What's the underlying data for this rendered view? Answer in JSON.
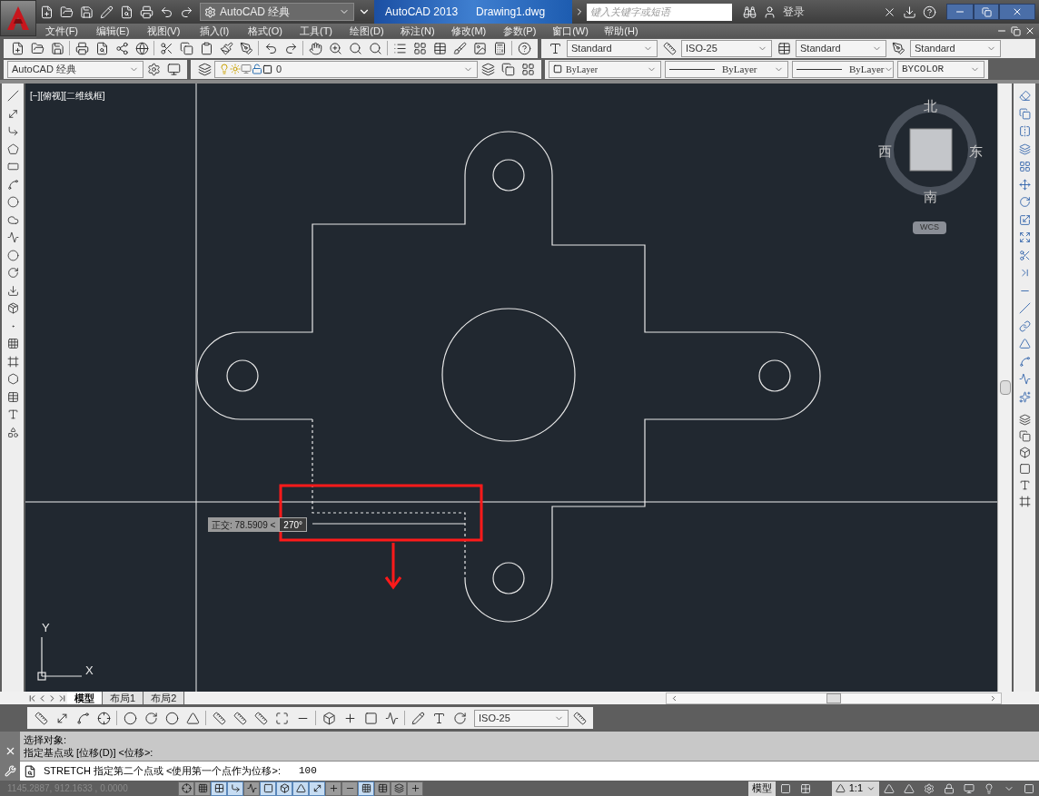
{
  "title_bar": {
    "workspace": "AutoCAD 经典",
    "app_name": "AutoCAD 2013",
    "document": "Drawing1.dwg",
    "search": {
      "placeholder": "键入关键字或短语"
    },
    "login": "登录"
  },
  "menu": [
    "文件(F)",
    "编辑(E)",
    "视图(V)",
    "插入(I)",
    "格式(O)",
    "工具(T)",
    "绘图(D)",
    "标注(N)",
    "修改(M)",
    "参数(P)",
    "窗口(W)",
    "帮助(H)"
  ],
  "styles_toolbar": {
    "text_style": "Standard",
    "dim_style": "ISO-25",
    "table_style": "Standard",
    "multileader_style": "Standard"
  },
  "layers_toolbar": {
    "workspace": "AutoCAD 经典",
    "layer": "0",
    "color_control": "ByLayer",
    "linetype": "ByLayer",
    "lineweight": "ByLayer",
    "plot_style": "BYCOLOR"
  },
  "viewport": {
    "label": "[−][俯视][二维线框]",
    "viewcube": {
      "north": "北",
      "south": "南",
      "east": "东",
      "west": "西",
      "ucs": "WCS"
    },
    "tooltip": {
      "label": "正交: 78.5909 <",
      "angle": "270°"
    },
    "ucs_icon": {
      "y": "Y",
      "x": "X"
    }
  },
  "layout_tabs": [
    {
      "label": "模型",
      "selected": true
    },
    {
      "label": "布局1",
      "selected": false
    },
    {
      "label": "布局2",
      "selected": false
    }
  ],
  "dimension_toolbar": {
    "dim_style": "ISO-25"
  },
  "command": {
    "history": [
      "选择对象:",
      "指定基点或 [位移(D)] <位移>:"
    ],
    "prompt": "STRETCH 指定第二个点或 <使用第一个点作为位移>:",
    "value": "100"
  },
  "status_bar": {
    "coordinates": "1145.2887, 912.1633 , 0.0000",
    "toggles": [
      {
        "on": false
      },
      {
        "on": false
      },
      {
        "on": true
      },
      {
        "on": true
      },
      {
        "on": false
      },
      {
        "on": true
      },
      {
        "on": true
      },
      {
        "on": true
      },
      {
        "on": true
      },
      {
        "on": false
      },
      {
        "on": false
      },
      {
        "on": true
      },
      {
        "on": false
      },
      {
        "on": false
      },
      {
        "on": false
      }
    ],
    "space": "模型",
    "annotation_scale": "1:1"
  }
}
